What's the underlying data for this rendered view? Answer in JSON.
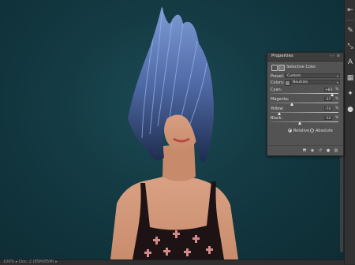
{
  "status": {
    "doc_info": "100% ▸ Doc: 2 (85M/85M) ▸"
  },
  "toolbar_icons": [
    "arrow-icon",
    "brush-icon",
    "transform-icon",
    "type-icon",
    "swatch-icon",
    "path-icon",
    "brush-preset-icon"
  ],
  "properties": {
    "title": "Properties",
    "panel_controls": "‹‹ ≡",
    "adjustment_name": "Selective Color",
    "preset_label": "Preset:",
    "preset_value": "Custom",
    "colors_label": "Colors:",
    "colors_value": "Neutrals",
    "sliders": [
      {
        "label": "Cyan:",
        "value": "+83",
        "unit": "%",
        "position": 0.915
      },
      {
        "label": "Magenta:",
        "value": "-37",
        "unit": "%",
        "position": 0.315
      },
      {
        "label": "Yellow:",
        "value": "-74",
        "unit": "%",
        "position": 0.13
      },
      {
        "label": "Black:",
        "value": "-12",
        "unit": "%",
        "position": 0.44
      }
    ],
    "method_relative": "Relative",
    "method_absolute": "Absolute",
    "selected_method": "relative",
    "footer_icons": [
      "clip-icon",
      "view-previous-icon",
      "reset-icon",
      "visibility-icon",
      "delete-icon"
    ]
  },
  "colors": {
    "panel_bg": "#535353",
    "canvas_bg": "#143a43"
  }
}
